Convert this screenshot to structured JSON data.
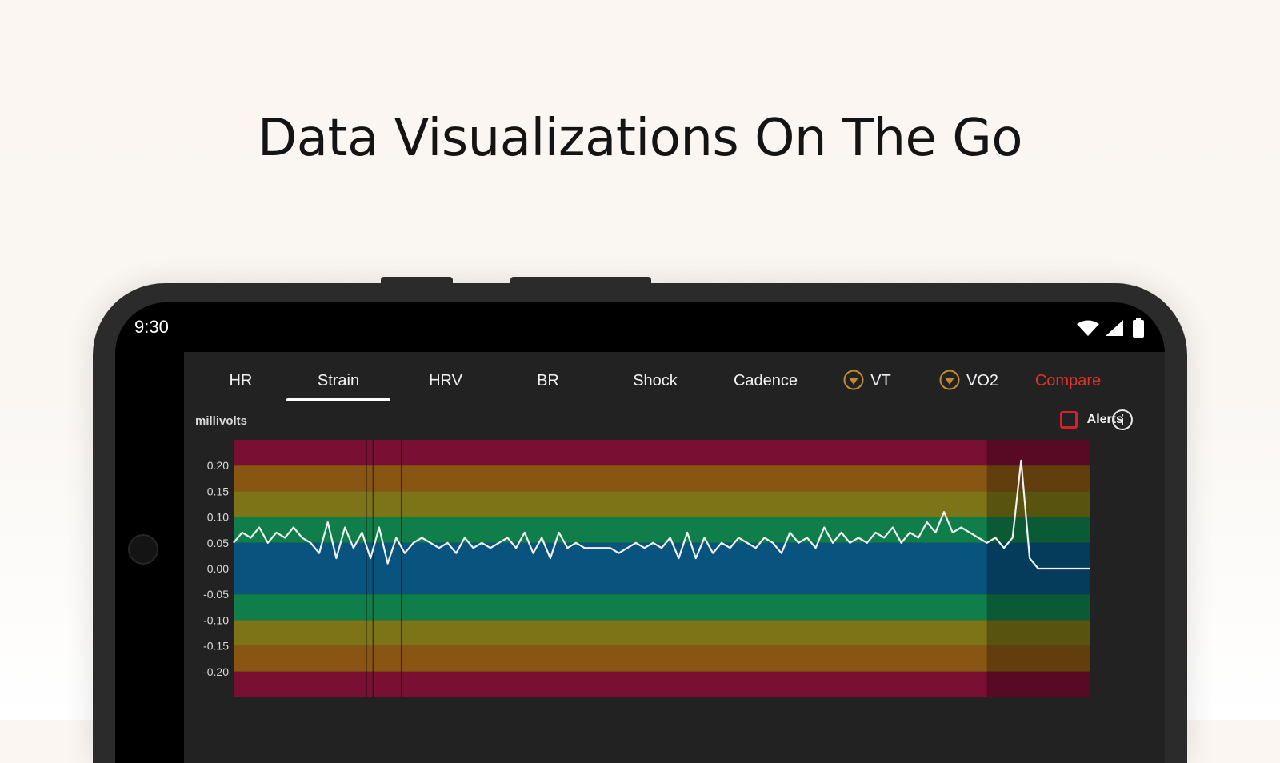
{
  "headline": "Data Visualizations On The Go",
  "status_bar": {
    "time": "9:30",
    "icons": [
      "wifi-icon",
      "cell-signal-icon",
      "battery-icon"
    ]
  },
  "tabs": [
    {
      "label": "HR",
      "active": false
    },
    {
      "label": "Strain",
      "active": true
    },
    {
      "label": "HRV",
      "active": false
    },
    {
      "label": "BR",
      "active": false
    },
    {
      "label": "Shock",
      "active": false
    },
    {
      "label": "Cadence",
      "active": false
    },
    {
      "label": "VT",
      "active": false,
      "premium": true
    },
    {
      "label": "VO2",
      "active": false,
      "premium": true
    },
    {
      "label": "Compare",
      "active": false,
      "accent": "#e2312b"
    }
  ],
  "unit_label": "millivolts",
  "alerts": {
    "label": "Alerts",
    "checked": false
  },
  "colors": {
    "accent_red": "#e2312b",
    "zone_red": "#7a0f34",
    "zone_orange": "#885513",
    "zone_olive": "#7c7417",
    "zone_green": "#0f7e4a",
    "zone_blue": "#08547e",
    "trace": "#f2f2f2"
  },
  "chart_data": {
    "type": "line",
    "title": "",
    "xlabel": "",
    "ylabel": "millivolts",
    "ylim": [
      -0.25,
      0.25
    ],
    "yticks": [
      "0.20",
      "0.15",
      "0.10",
      "0.05",
      "0.00",
      "-0.05",
      "-0.10",
      "-0.15",
      "-0.20"
    ],
    "zones": [
      {
        "from": 0.2,
        "to": 0.25,
        "color": "#7a0f34"
      },
      {
        "from": 0.15,
        "to": 0.2,
        "color": "#885513"
      },
      {
        "from": 0.1,
        "to": 0.15,
        "color": "#7c7417"
      },
      {
        "from": 0.05,
        "to": 0.1,
        "color": "#0f7e4a"
      },
      {
        "from": -0.05,
        "to": 0.05,
        "color": "#08547e"
      },
      {
        "from": -0.1,
        "to": -0.05,
        "color": "#0f7e4a"
      },
      {
        "from": -0.15,
        "to": -0.1,
        "color": "#7c7417"
      },
      {
        "from": -0.2,
        "to": -0.15,
        "color": "#885513"
      },
      {
        "from": -0.25,
        "to": -0.2,
        "color": "#7a0f34"
      }
    ],
    "x": [
      0,
      1,
      2,
      3,
      4,
      5,
      6,
      7,
      8,
      9,
      10,
      11,
      12,
      13,
      14,
      15,
      16,
      17,
      18,
      19,
      20,
      21,
      22,
      23,
      24,
      25,
      26,
      27,
      28,
      29,
      30,
      31,
      32,
      33,
      34,
      35,
      36,
      37,
      38,
      39,
      40,
      41,
      42,
      43,
      44,
      45,
      46,
      47,
      48,
      49,
      50,
      51,
      52,
      53,
      54,
      55,
      56,
      57,
      58,
      59,
      60,
      61,
      62,
      63,
      64,
      65,
      66,
      67,
      68,
      69,
      70,
      71,
      72,
      73,
      74,
      75,
      76,
      77,
      78,
      79,
      80,
      81,
      82,
      83,
      84,
      85,
      86,
      87,
      88,
      89,
      90,
      91,
      92,
      93,
      94,
      95,
      96,
      97,
      98,
      99,
      100
    ],
    "series": [
      {
        "values": [
          0.05,
          0.07,
          0.06,
          0.08,
          0.05,
          0.07,
          0.06,
          0.08,
          0.06,
          0.05,
          0.03,
          0.09,
          0.02,
          0.08,
          0.04,
          0.07,
          0.02,
          0.08,
          0.01,
          0.06,
          0.03,
          0.05,
          0.06,
          0.05,
          0.04,
          0.05,
          0.03,
          0.06,
          0.04,
          0.05,
          0.04,
          0.05,
          0.06,
          0.04,
          0.07,
          0.03,
          0.06,
          0.02,
          0.07,
          0.04,
          0.05,
          0.04,
          0.04,
          0.04,
          0.04,
          0.03,
          0.04,
          0.05,
          0.04,
          0.05,
          0.04,
          0.06,
          0.02,
          0.07,
          0.02,
          0.06,
          0.03,
          0.05,
          0.04,
          0.06,
          0.05,
          0.04,
          0.06,
          0.05,
          0.03,
          0.07,
          0.05,
          0.06,
          0.04,
          0.08,
          0.05,
          0.07,
          0.05,
          0.06,
          0.05,
          0.07,
          0.06,
          0.08,
          0.05,
          0.07,
          0.06,
          0.09,
          0.07,
          0.11,
          0.07,
          0.08,
          0.07,
          0.06,
          0.05,
          0.06,
          0.04,
          0.06,
          0.21,
          0.02,
          0.0,
          0.0,
          0.0,
          0.0,
          0.0,
          0.0,
          0.0
        ]
      }
    ],
    "markers_x": [
      15.5,
      16.3,
      19.6
    ],
    "shaded_from_x": 88,
    "grid": false,
    "legend": "none"
  }
}
